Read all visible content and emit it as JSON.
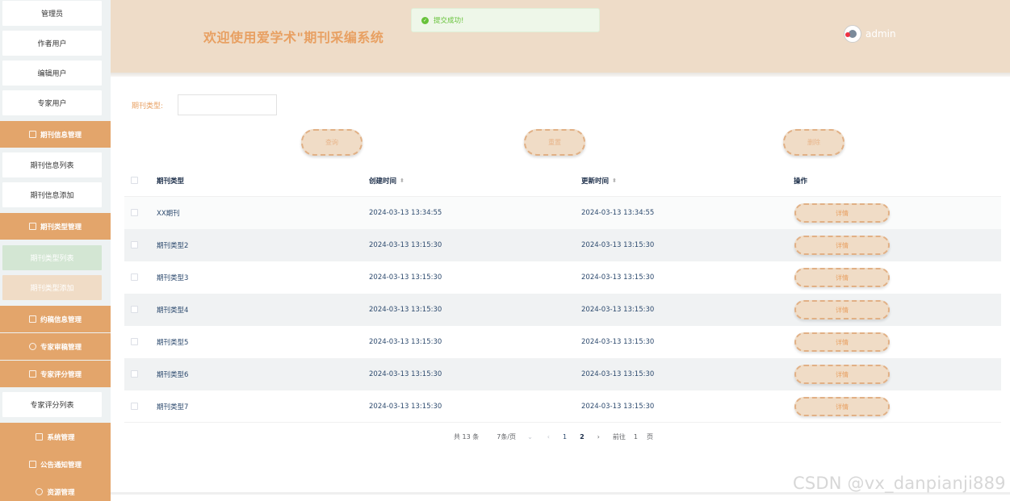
{
  "sidebar": {
    "items": [
      {
        "label": "管理员",
        "kind": "sub"
      },
      {
        "label": "作者用户",
        "kind": "sub"
      },
      {
        "label": "编辑用户",
        "kind": "sub"
      },
      {
        "label": "专家用户",
        "kind": "sub"
      },
      {
        "label": "期刊信息管理",
        "kind": "group",
        "icon": "edit-icon"
      },
      {
        "label": "期刊信息列表",
        "kind": "sub"
      },
      {
        "label": "期刊信息添加",
        "kind": "sub"
      },
      {
        "label": "期刊类型管理",
        "kind": "group",
        "icon": "list-icon"
      },
      {
        "label": "期刊类型列表",
        "kind": "sub",
        "state": "active"
      },
      {
        "label": "期刊类型添加",
        "kind": "sub",
        "state": "hover"
      },
      {
        "label": "约稿信息管理",
        "kind": "group",
        "icon": "edit-icon"
      },
      {
        "label": "专家审稿管理",
        "kind": "group",
        "icon": "chat-icon"
      },
      {
        "label": "专家评分管理",
        "kind": "group",
        "icon": "list-icon"
      },
      {
        "label": "专家评分列表",
        "kind": "sub"
      },
      {
        "label": "系统管理",
        "kind": "group",
        "icon": "system-icon"
      },
      {
        "label": "公告通知管理",
        "kind": "group",
        "icon": "edit-icon"
      },
      {
        "label": "资源管理",
        "kind": "group",
        "icon": "chat-icon"
      }
    ]
  },
  "header": {
    "title": "欢迎使用爱学术\"期刊采编系统",
    "username": "admin"
  },
  "toast": {
    "message": "提交成功!",
    "color": "#67c23a"
  },
  "search": {
    "label": "期刊类型:",
    "value": "",
    "placeholder": "",
    "query_label": "查询",
    "reset_label": "重置",
    "delete_label": "删除"
  },
  "table": {
    "columns": [
      "期刊类型",
      "创建时间",
      "更新时间",
      "操作"
    ],
    "rows": [
      {
        "type": "XX期刊",
        "created": "2024-03-13 13:34:55",
        "updated": "2024-03-13 13:34:55",
        "action": "详情"
      },
      {
        "type": "期刊类型2",
        "created": "2024-03-13 13:15:30",
        "updated": "2024-03-13 13:15:30",
        "action": "详情"
      },
      {
        "type": "期刊类型3",
        "created": "2024-03-13 13:15:30",
        "updated": "2024-03-13 13:15:30",
        "action": "详情"
      },
      {
        "type": "期刊类型4",
        "created": "2024-03-13 13:15:30",
        "updated": "2024-03-13 13:15:30",
        "action": "详情"
      },
      {
        "type": "期刊类型5",
        "created": "2024-03-13 13:15:30",
        "updated": "2024-03-13 13:15:30",
        "action": "详情"
      },
      {
        "type": "期刊类型6",
        "created": "2024-03-13 13:15:30",
        "updated": "2024-03-13 13:15:30",
        "action": "详情"
      },
      {
        "type": "期刊类型7",
        "created": "2024-03-13 13:15:30",
        "updated": "2024-03-13 13:15:30",
        "action": "详情"
      }
    ]
  },
  "pagination": {
    "total": "共 13 条",
    "page_size": "7条/页",
    "pages": [
      "1",
      "2"
    ],
    "current": "2",
    "goto_label": "前往",
    "goto_value": "1",
    "page_suffix": "页"
  },
  "watermark": "CSDN @vx_danpianji889",
  "colors": {
    "accent": "#e3a56b",
    "header_bg": "#eedcc8",
    "title": "#e8a062",
    "active_green": "#d3e6d3"
  }
}
